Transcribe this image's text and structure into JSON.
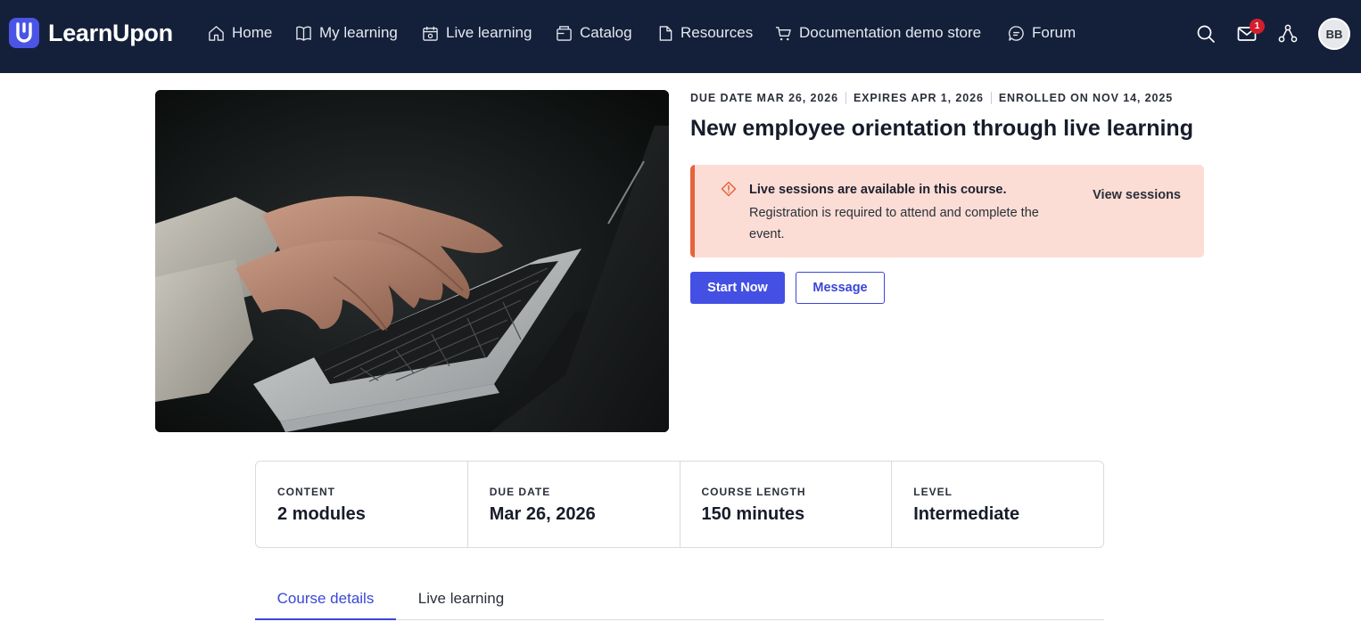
{
  "app": {
    "brand": "LearnUpon"
  },
  "nav": [
    {
      "label": "Home",
      "icon": "home-icon"
    },
    {
      "label": "My learning",
      "icon": "book-icon"
    },
    {
      "label": "Live learning",
      "icon": "calendar-icon"
    },
    {
      "label": "Catalog",
      "icon": "catalog-icon"
    },
    {
      "label": "Resources",
      "icon": "document-icon"
    },
    {
      "label": "Documentation demo store",
      "icon": "cart-icon"
    },
    {
      "label": "Forum",
      "icon": "chat-icon"
    }
  ],
  "header": {
    "message_count": "1",
    "avatar_initials": "BB",
    "icons": [
      "search-icon",
      "mail-icon",
      "org-chart-icon"
    ]
  },
  "course": {
    "meta": [
      "DUE DATE MAR 26, 2026",
      "EXPIRES APR 1, 2026",
      "ENROLLED ON NOV 14, 2025"
    ],
    "title": "New employee orientation through live learning",
    "alert": {
      "heading": "Live sessions are available in this course.",
      "body": "Registration is required to attend and complete the event.",
      "link": "View sessions",
      "icon": "warning-diamond-icon",
      "accent": "#e8623c"
    },
    "primary_button": "Start Now",
    "secondary_button": "Message"
  },
  "stats": [
    {
      "label": "CONTENT",
      "value": "2 modules"
    },
    {
      "label": "DUE DATE",
      "value": "Mar 26, 2026"
    },
    {
      "label": "COURSE LENGTH",
      "value": "150 minutes"
    },
    {
      "label": "LEVEL",
      "value": "Intermediate"
    }
  ],
  "tabs": [
    {
      "label": "Course details",
      "active": true
    },
    {
      "label": "Live learning",
      "active": false
    }
  ],
  "colors": {
    "header_bg": "#14203a",
    "brand": "#4a55e6",
    "primary": "#4450e3",
    "alert_bg": "#fcddd5",
    "badge": "#d41e2c"
  }
}
